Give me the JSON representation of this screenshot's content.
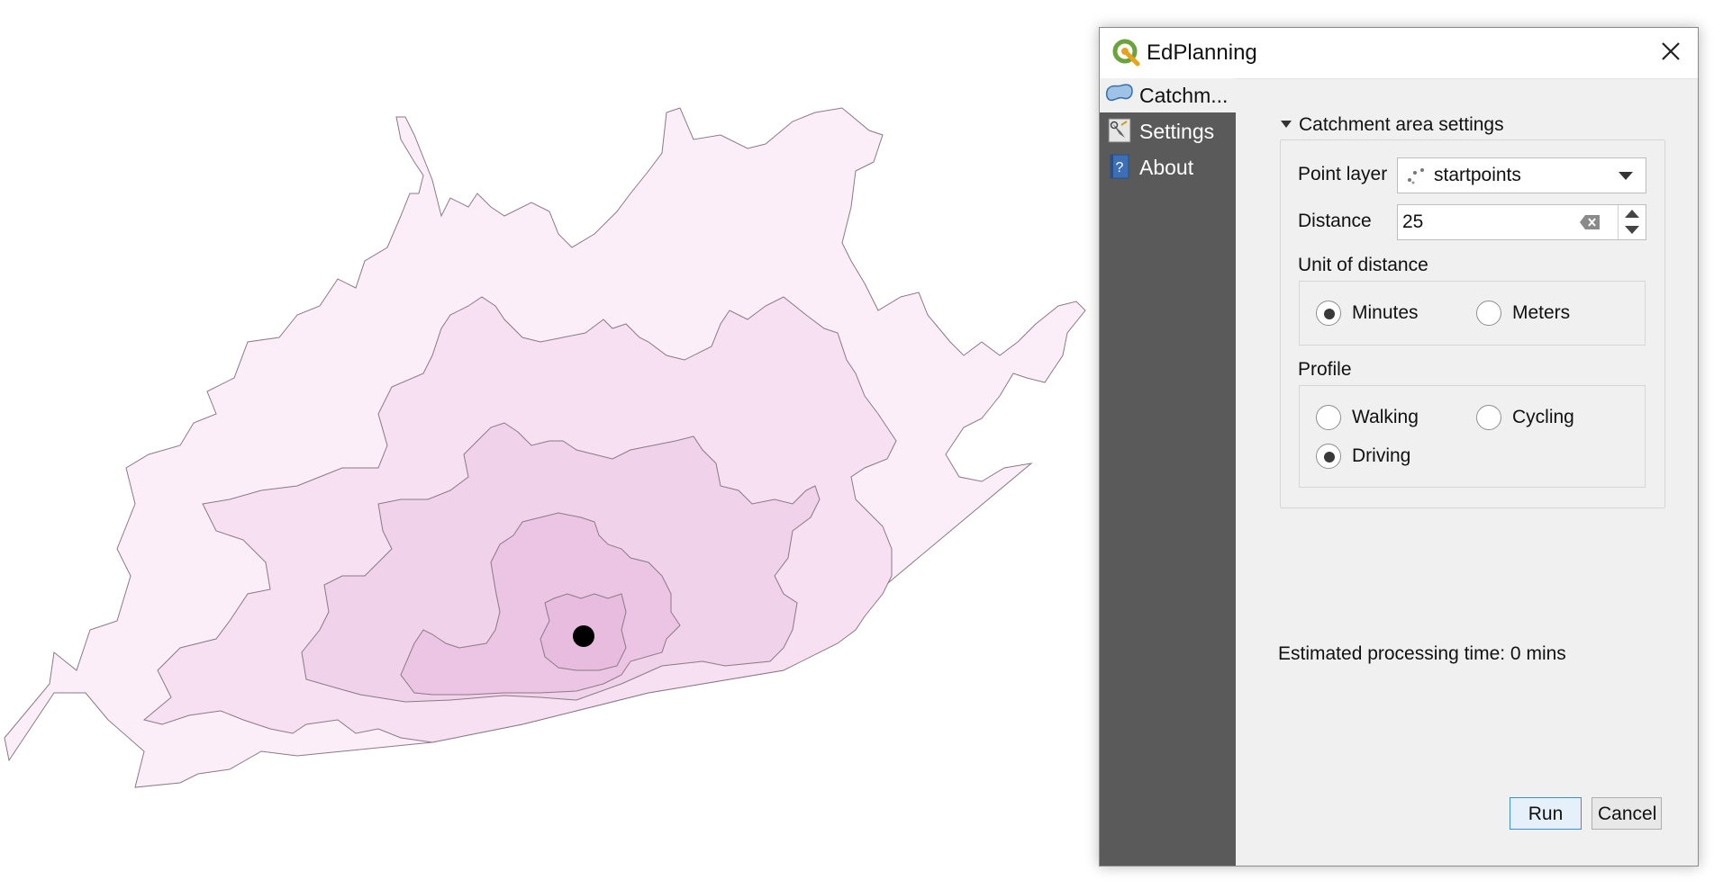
{
  "dialog": {
    "title": "EdPlanning",
    "close_icon": "close-icon",
    "app_icon": "qgis-logo-icon"
  },
  "sidebar": {
    "items": [
      {
        "label": "Catchm...",
        "icon": "catchment-icon",
        "selected": true
      },
      {
        "label": "Settings",
        "icon": "settings-icon",
        "selected": false
      },
      {
        "label": "About",
        "icon": "help-icon",
        "selected": false
      }
    ]
  },
  "catchment": {
    "group_title": "Catchment area settings",
    "point_layer_label": "Point layer",
    "point_layer_value": "startpoints",
    "distance_label": "Distance",
    "distance_value": "25",
    "unit_label": "Unit of distance",
    "unit_options": [
      {
        "label": "Minutes",
        "checked": true
      },
      {
        "label": "Meters",
        "checked": false
      }
    ],
    "profile_label": "Profile",
    "profile_options": [
      {
        "label": "Walking",
        "checked": false
      },
      {
        "label": "Cycling",
        "checked": false
      },
      {
        "label": "Driving",
        "checked": true
      }
    ],
    "estimate_text": "Estimated processing time: 0 mins"
  },
  "buttons": {
    "run": "Run",
    "cancel": "Cancel"
  },
  "colors": {
    "outer_fill": "#fbeef8",
    "mid_fill": "#f6e0f1",
    "inner_fill": "#f0d2ea",
    "core_fill": "#ebc5e3",
    "outline": "#8a7a86",
    "start_point": "#000000",
    "sidebar_bg": "#5a5a5a"
  }
}
